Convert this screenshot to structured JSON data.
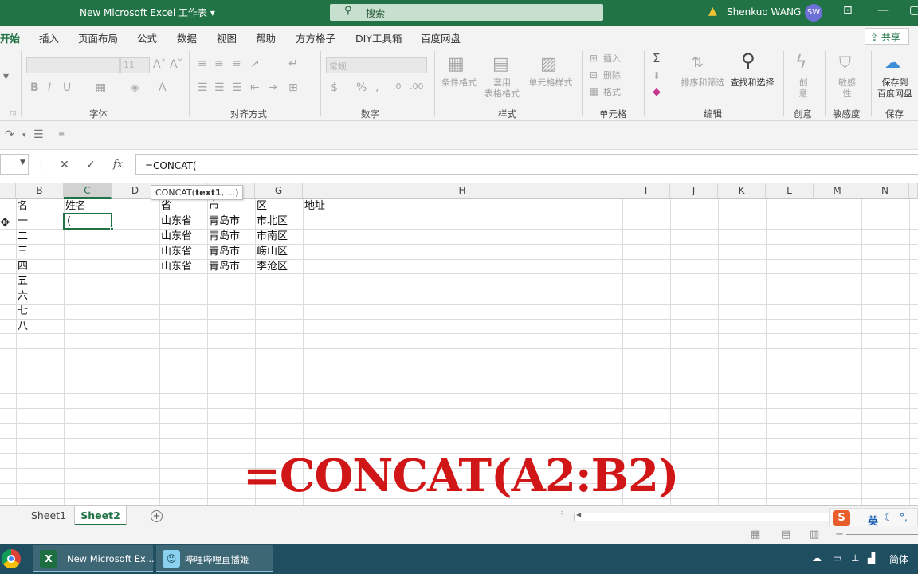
{
  "titlebar": {
    "title": "New Microsoft Excel 工作表 ▾",
    "search_placeholder": "搜索",
    "user_name": "Shenkuo WANG",
    "user_initials": "SW"
  },
  "ribbon_tabs": [
    "开始",
    "插入",
    "页面布局",
    "公式",
    "数据",
    "视图",
    "帮助",
    "方方格子",
    "DIY工具箱",
    "百度网盘"
  ],
  "share_label": "共享",
  "ribbon": {
    "font_size": "11",
    "number_format": "常规",
    "groups": {
      "font": "字体",
      "alignment": "对齐方式",
      "number": "数字",
      "styles": "样式",
      "cells": "单元格",
      "editing": "编辑",
      "creative": "创意",
      "sensitivity": "敏感度",
      "save": "保存"
    },
    "styles_buttons": [
      "条件格式",
      "套用\n表格格式",
      "单元格样式"
    ],
    "cells_buttons": [
      "插入",
      "删除",
      "格式"
    ],
    "sort_filter": "排序和筛选",
    "find_select": "查找和选择",
    "creative_btn": "创\n意",
    "sensitivity_btn": "敏感\n性",
    "save_baidu": "保存到\n百度网盘"
  },
  "formula_bar": {
    "formula": "=CONCAT("
  },
  "columns": [
    "B",
    "C",
    "D",
    "E",
    "F",
    "G",
    "H",
    "I",
    "J",
    "K",
    "L",
    "M",
    "N"
  ],
  "tooltip": {
    "fn": "CONCAT(",
    "arg": "text1",
    "rest": ", ...)"
  },
  "cells": {
    "b_col": [
      "名",
      "一",
      "二",
      "三",
      "四",
      "五",
      "六",
      "七",
      "八"
    ],
    "c_header": "姓名",
    "active_value": "(",
    "province_header": "省",
    "city_header": "市",
    "district_header": "区",
    "address_header": "地址",
    "rows": [
      {
        "province": "山东省",
        "city": "青岛市",
        "district": "市北区"
      },
      {
        "province": "山东省",
        "city": "青岛市",
        "district": "市南区"
      },
      {
        "province": "山东省",
        "city": "青岛市",
        "district": "崂山区"
      },
      {
        "province": "山东省",
        "city": "青岛市",
        "district": "李沧区"
      }
    ]
  },
  "overlay_formula": "=CONCAT(A2:B2)",
  "sheets": [
    "Sheet1",
    "Sheet2"
  ],
  "active_sheet": "Sheet2",
  "ime": {
    "logo": "S",
    "lang": "英"
  },
  "taskbar": {
    "excel_task": "New Microsoft Ex...",
    "bilibili_task": "哔哩哔哩直播姬",
    "tray_lang": "简体"
  },
  "colors": {
    "excel_green": "#217346",
    "overlay_red": "#d01616",
    "taskbar": "#1f4e60"
  }
}
